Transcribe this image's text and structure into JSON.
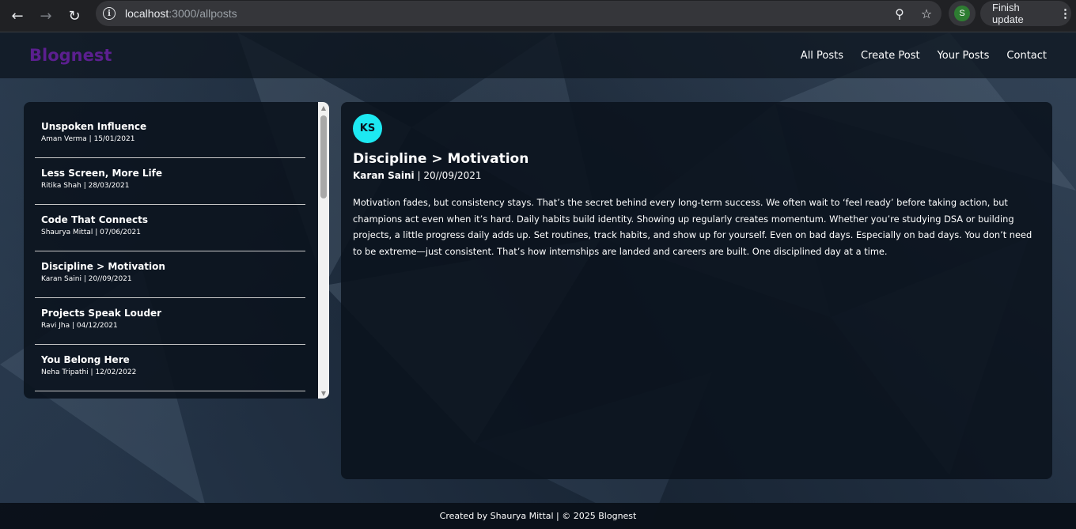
{
  "browser": {
    "url_host": "localhost",
    "url_path": ":3000/allposts",
    "profile_initial": "S",
    "update_label": "Finish update"
  },
  "site": {
    "brand": "Blognest",
    "nav": [
      "All Posts",
      "Create Post",
      "Your Posts",
      "Contact"
    ]
  },
  "posts": [
    {
      "title": "Unspoken Influence",
      "meta": "Aman Verma | 15/01/2021"
    },
    {
      "title": "Less Screen, More Life",
      "meta": "Ritika Shah | 28/03/2021"
    },
    {
      "title": "Code That Connects",
      "meta": "Shaurya Mittal | 07/06/2021"
    },
    {
      "title": "Discipline > Motivation",
      "meta": "Karan Saini | 20//09/2021"
    },
    {
      "title": "Projects Speak Louder",
      "meta": "Ravi Jha | 04/12/2021"
    },
    {
      "title": "You Belong Here",
      "meta": "Neha Tripathi | 12/02/2022"
    }
  ],
  "selected_post": {
    "initials": "KS",
    "title": "Discipline > Motivation",
    "author": "Karan Saini",
    "date": " | 20//09/2021",
    "body": "Motivation fades, but consistency stays. That’s the secret behind every long-term success. We often wait to ‘feel ready’ before taking action, but champions act even when it’s hard. Daily habits build identity. Showing up regularly creates momentum. Whether you’re studying DSA or building projects, a little progress daily adds up. Set routines, track habits, and show up for yourself. Even on bad days. Especially on bad days. You don’t need to be extreme—just consistent. That’s how internships are landed and careers are built. One disciplined day at a time."
  },
  "footer": "Created by Shaurya Mittal | © 2025 Blognest",
  "colors": {
    "brand": "#5b1f8f",
    "avatar": "#1de9f2"
  }
}
